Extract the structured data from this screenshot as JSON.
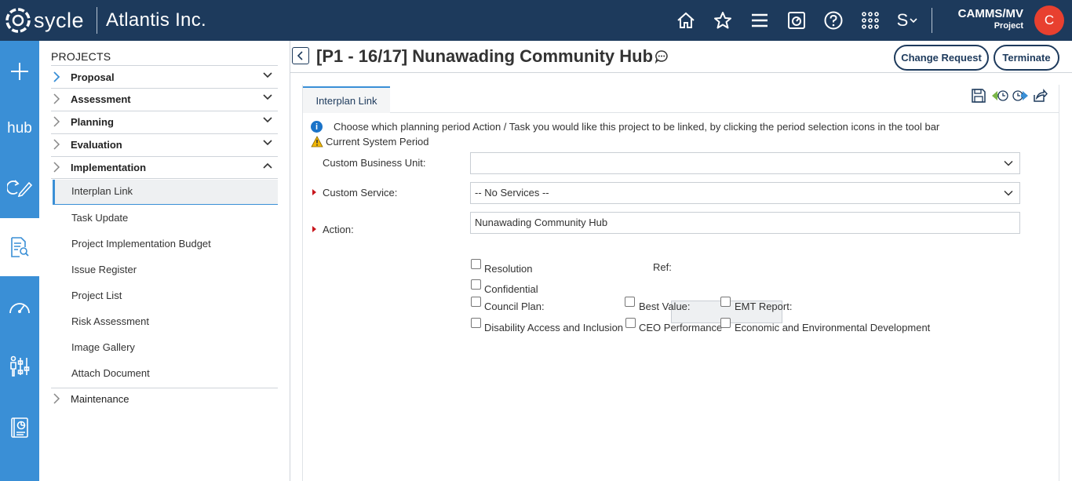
{
  "header": {
    "logo_text": "sycle",
    "org_name": "Atlantis Inc.",
    "user_name": "CAMMS/MV",
    "user_role": "Project",
    "avatar_initial": "C",
    "icons": [
      "home-icon",
      "star-icon",
      "menu-icon",
      "dashboard-icon",
      "help-icon",
      "apps-grid-icon",
      "s-dropdown-icon"
    ],
    "s_menu_label": "S"
  },
  "rail": {
    "items": [
      {
        "name": "add",
        "icon": "plus-icon"
      },
      {
        "name": "hub",
        "label": "hub"
      },
      {
        "name": "edit-cycle",
        "icon": "edit-cycle-icon"
      },
      {
        "name": "project-search",
        "icon": "document-search-icon",
        "active": true
      },
      {
        "name": "gauge",
        "icon": "gauge-icon"
      },
      {
        "name": "people-settings",
        "icon": "people-sliders-icon"
      },
      {
        "name": "report",
        "icon": "report-icon"
      }
    ]
  },
  "sidebar": {
    "title": "PROJECTS",
    "sections": [
      {
        "label": "Proposal",
        "expanded": false
      },
      {
        "label": "Assessment",
        "expanded": false
      },
      {
        "label": "Planning",
        "expanded": false
      },
      {
        "label": "Evaluation",
        "expanded": false
      },
      {
        "label": "Implementation",
        "expanded": true
      }
    ],
    "sub_items": [
      {
        "label": "Interplan Link",
        "active": true
      },
      {
        "label": "Task Update"
      },
      {
        "label": "Project Implementation Budget"
      },
      {
        "label": "Issue Register"
      },
      {
        "label": "Project List"
      },
      {
        "label": "Risk Assessment"
      },
      {
        "label": "Image Gallery"
      },
      {
        "label": "Attach Document"
      }
    ],
    "maintenance": "Maintenance"
  },
  "main": {
    "page_title": "[P1 - 16/17] Nunawading Community Hub",
    "buttons": {
      "change_request": "Change Request",
      "terminate": "Terminate"
    },
    "tab_label": "Interplan Link",
    "info_text": "Choose which planning period Action / Task you would like this project to be linked, by clicking the period selection icons in the tool bar",
    "warning_text": "Current System Period",
    "form": {
      "business_unit_label": "Custom Business Unit:",
      "business_unit_value": "",
      "service_label": "Custom Service:",
      "service_value": "-- No Services --",
      "action_label": "Action:",
      "action_value": "Nunawading Community Hub",
      "ref_label": "Ref:",
      "ref_value": "",
      "checkboxes": {
        "resolution": "Resolution",
        "confidential": "Confidential",
        "council_plan": "Council Plan:",
        "best_value": "Best Value:",
        "emt_report": "EMT Report:",
        "disability": "Disability Access and Inclusion",
        "ceo": "CEO Performance",
        "economic": "Economic and Environmental Development"
      }
    }
  },
  "colors": {
    "header_bg": "#1d3a5c",
    "rail_bg": "#3a8fd6",
    "avatar_bg": "#e8402f",
    "required_marker": "#c8161d"
  }
}
